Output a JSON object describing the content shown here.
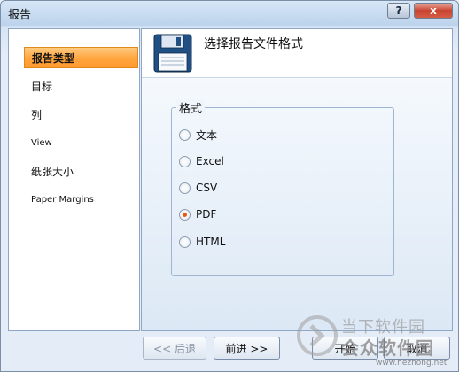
{
  "window": {
    "title": "报告"
  },
  "titlebar": {
    "help_icon": "?",
    "close_icon": "x"
  },
  "sidebar": {
    "items": [
      {
        "label": "报告类型",
        "active": true
      },
      {
        "label": "目标",
        "active": false
      },
      {
        "label": "列",
        "active": false
      },
      {
        "label": "View",
        "active": false
      },
      {
        "label": "纸张大小",
        "active": false
      },
      {
        "label": "Paper Margins",
        "active": false
      }
    ]
  },
  "header": {
    "icon": "floppy-disk-icon",
    "title": "选择报告文件格式"
  },
  "format_group": {
    "legend": "格式",
    "options": [
      {
        "label": "文本",
        "checked": false
      },
      {
        "label": "Excel",
        "checked": false
      },
      {
        "label": "CSV",
        "checked": false
      },
      {
        "label": "PDF",
        "checked": true
      },
      {
        "label": "HTML",
        "checked": false
      }
    ]
  },
  "buttons": {
    "back": "<< 后退",
    "next": "前进 >>",
    "start": "开始",
    "cancel": "取消"
  },
  "watermark": {
    "line1": "当下软件园",
    "line2": "会众软件园",
    "url": "www.hezhong.net"
  }
}
